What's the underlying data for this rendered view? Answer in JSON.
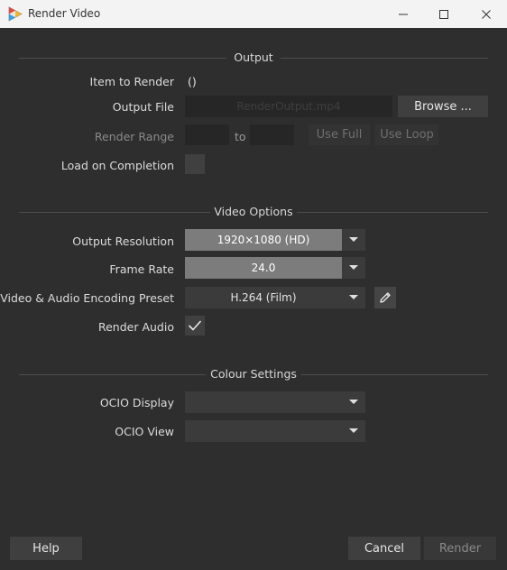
{
  "window": {
    "title": "Render Video"
  },
  "output": {
    "section_title": "Output",
    "item_to_render_label": "Item to Render",
    "item_to_render_value": "()",
    "output_file_label": "Output File",
    "output_file_placeholder": "RenderOutput.mp4",
    "browse_label": "Browse ...",
    "render_range_label": "Render Range",
    "range_to_label": "to",
    "use_full_label": "Use Full",
    "use_loop_label": "Use Loop",
    "load_on_completion_label": "Load on Completion",
    "load_on_completion_checked": false
  },
  "video_options": {
    "section_title": "Video Options",
    "output_resolution_label": "Output Resolution",
    "output_resolution_value": "1920×1080 (HD)",
    "frame_rate_label": "Frame Rate",
    "frame_rate_value": "24.0",
    "encoding_preset_label": "Video & Audio Encoding Preset",
    "encoding_preset_value": "H.264 (Film)",
    "render_audio_label": "Render Audio",
    "render_audio_checked": true
  },
  "colour_settings": {
    "section_title": "Colour Settings",
    "ocio_display_label": "OCIO Display",
    "ocio_display_value": "",
    "ocio_view_label": "OCIO View",
    "ocio_view_value": ""
  },
  "footer": {
    "help_label": "Help",
    "cancel_label": "Cancel",
    "render_label": "Render"
  },
  "icons": {
    "app": "render-app-icon",
    "minimize": "minimize-icon",
    "maximize": "maximize-icon",
    "close": "close-icon",
    "dropdown": "chevron-down-icon",
    "edit": "pencil-icon",
    "check": "checkmark-icon"
  }
}
